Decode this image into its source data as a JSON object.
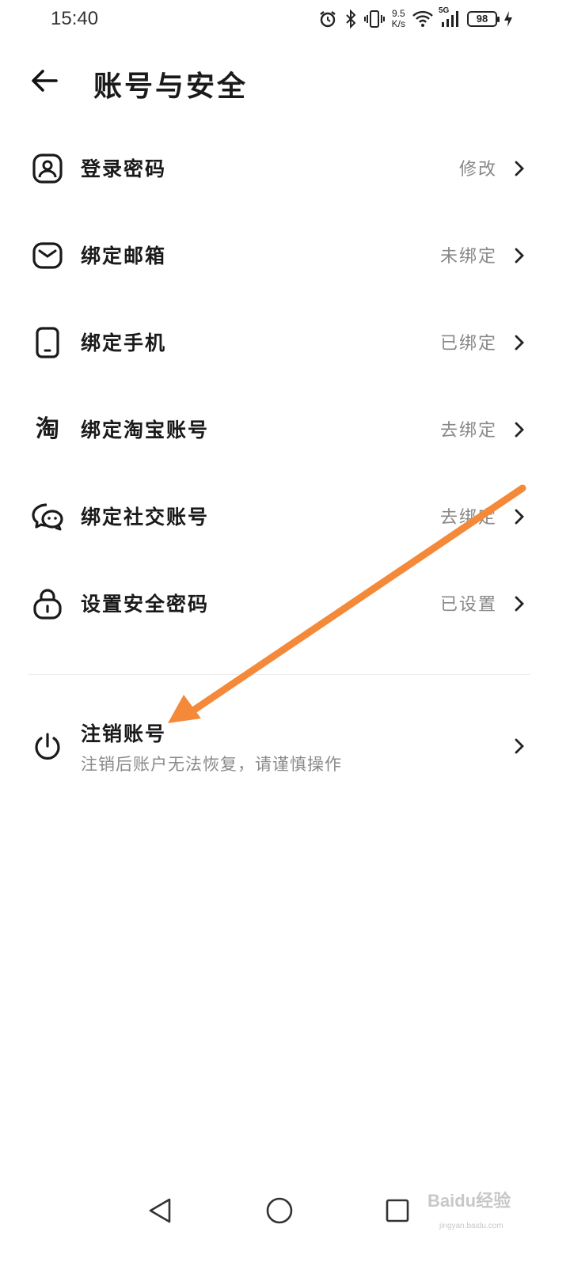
{
  "status_bar": {
    "time": "15:40",
    "net_speed_value": "9.5",
    "net_speed_unit": "K/s",
    "signal_label": "5G",
    "battery_level": "98",
    "icons": [
      "alarm-icon",
      "bluetooth-icon",
      "vibrate-icon",
      "wifi-icon",
      "signal-icon",
      "battery-icon",
      "charging-icon"
    ]
  },
  "header": {
    "title": "账号与安全"
  },
  "settings": {
    "items": [
      {
        "label": "登录密码",
        "value": "修改",
        "icon": "user-lock-icon"
      },
      {
        "label": "绑定邮箱",
        "value": "未绑定",
        "icon": "mail-icon"
      },
      {
        "label": "绑定手机",
        "value": "已绑定",
        "icon": "phone-icon"
      },
      {
        "label": "绑定淘宝账号",
        "value": "去绑定",
        "icon": "taobao-icon",
        "icon_glyph": "淘"
      },
      {
        "label": "绑定社交账号",
        "value": "去绑定",
        "icon": "chat-icon"
      },
      {
        "label": "设置安全密码",
        "value": "已设置",
        "icon": "lock-icon"
      }
    ]
  },
  "deregister": {
    "label": "注销账号",
    "warning": "注销后账户无法恢复，请谨慎操作",
    "icon": "power-icon"
  },
  "annotation": {
    "type": "arrow",
    "color": "#F5893A"
  },
  "nav_bar": {
    "buttons": [
      "back-triangle-icon",
      "home-circle-icon",
      "recents-square-icon"
    ]
  },
  "watermark": {
    "text": "Baidu经验",
    "site": "jingyan.baidu.com"
  }
}
